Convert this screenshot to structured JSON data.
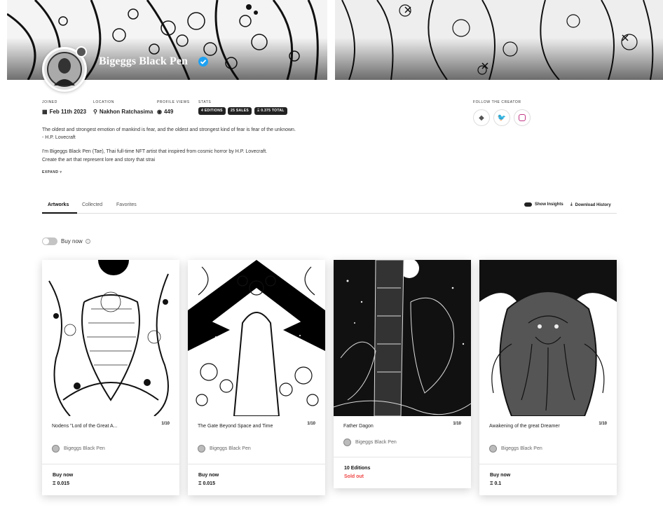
{
  "profile": {
    "name": "Bigeggs Black Pen",
    "joined_label": "Joined",
    "joined_value": "Feb 11th 2023",
    "location_label": "Location",
    "location_value": "Nakhon Ratchasima",
    "views_label": "Profile views",
    "views_value": "449",
    "stats_label": "Stats",
    "stats": [
      "4 editions",
      "25 sales",
      "Ξ 0.375 total"
    ],
    "follow_label": "Follow the creator",
    "bio_lines": [
      "The oldest and strongest emotion of mankind is fear, and the oldest and strongest kind of fear is fear of the unknown.",
      "- H.P. Lovecraft",
      "I'm Bigeggs Black Pen (Tae), Thai full-time NFT artist that inspired from cosmic horror by H.P. Lovecraft.",
      "Create the art that represent lore and story that strai"
    ],
    "expand_label": "Expand"
  },
  "tabs": [
    "Artworks",
    "Collected",
    "Favorites"
  ],
  "tools": {
    "insights": "Show Insights",
    "download": "Download History"
  },
  "filter": {
    "buy_now": "Buy now"
  },
  "cards": [
    {
      "title": "Nodens \"Lord of the Great A...",
      "editions": "1/10",
      "creator": "Bigeggs Black Pen",
      "status": "Buy now",
      "price": "Ξ 0.015"
    },
    {
      "title": "The Gate Beyond Space and Time",
      "editions": "1/10",
      "creator": "Bigeggs Black Pen",
      "status": "Buy now",
      "price": "Ξ 0.015"
    },
    {
      "title": "Father Dagon",
      "editions": "1/10",
      "creator": "Bigeggs Black Pen",
      "status": "10 Editions",
      "price": "Sold out"
    },
    {
      "title": "Awakening of the great Dreamer",
      "editions": "1/10",
      "creator": "Bigeggs Black Pen",
      "status": "Buy now",
      "price": "Ξ 0.1"
    }
  ],
  "colors": {
    "verified": "#1da1f2",
    "sold_out": "#ef4444",
    "pill": "#222222"
  }
}
